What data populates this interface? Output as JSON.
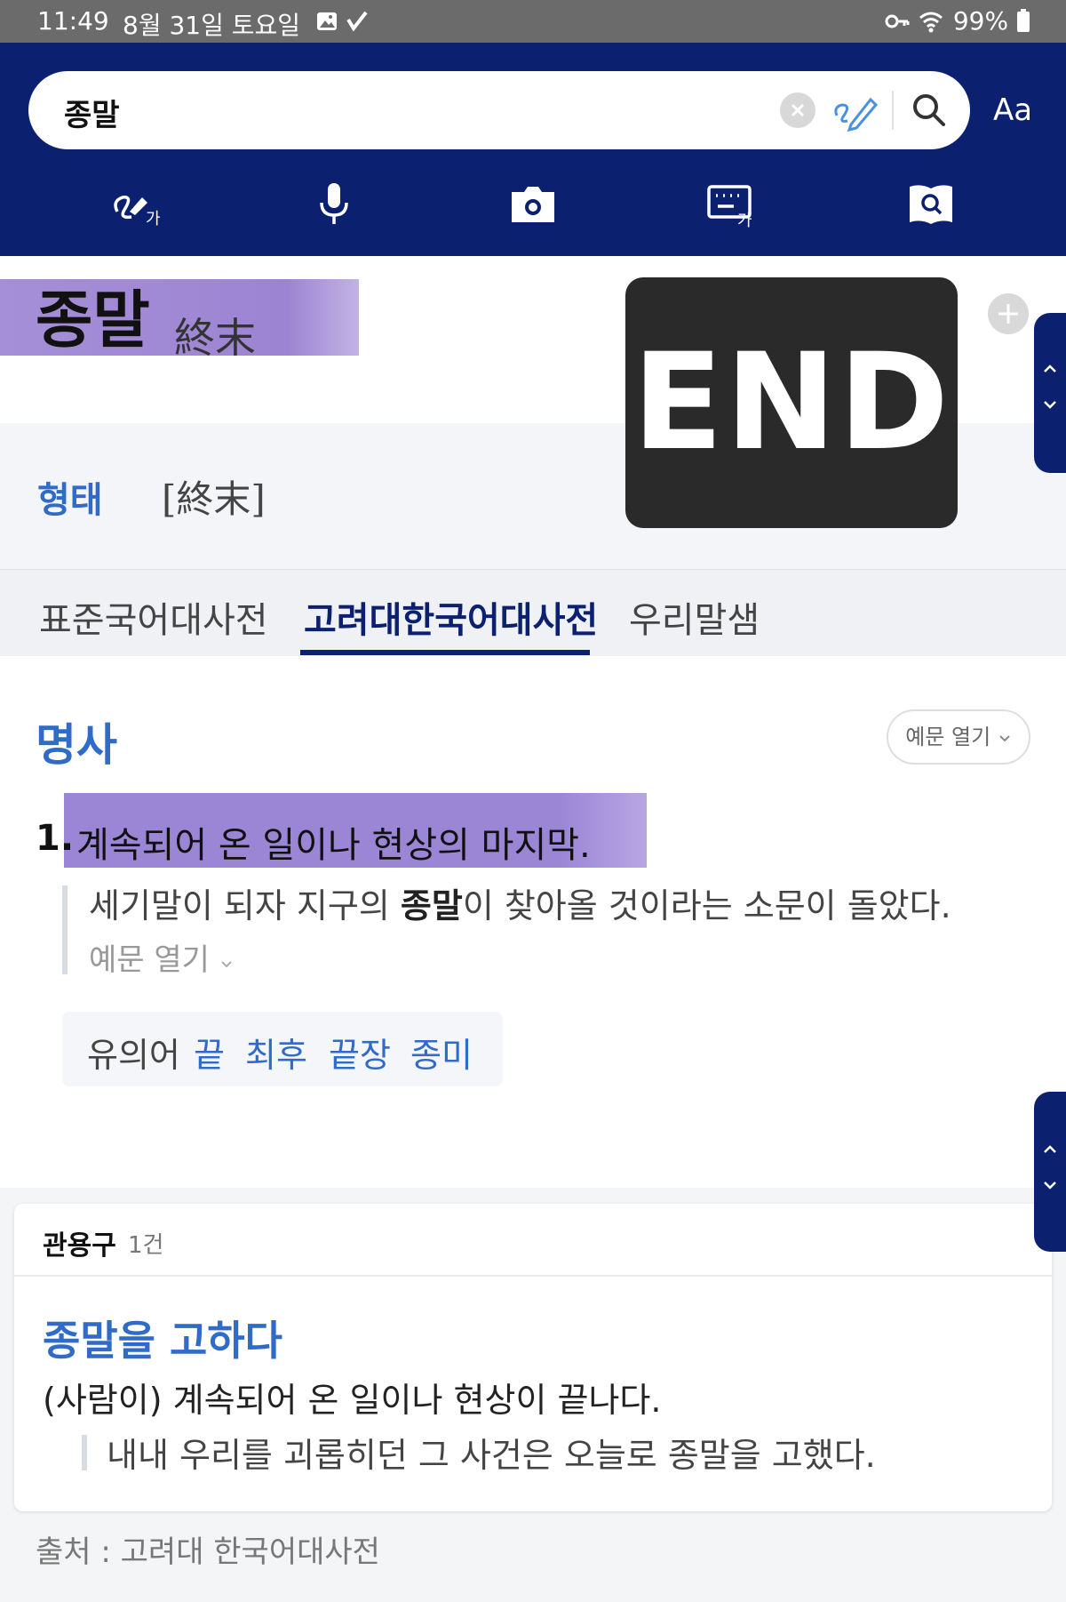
{
  "status_bar": {
    "time": "11:49",
    "date": "8월 31일 토요일",
    "battery": "99%",
    "icons": [
      "gallery-icon",
      "check-icon",
      "key-icon",
      "wifi-icon",
      "battery-icon"
    ]
  },
  "search": {
    "query": "종말",
    "font_size_button": "Aa"
  },
  "toolbar": {
    "tools": [
      "handwriting-icon",
      "microphone-icon",
      "camera-icon",
      "keyboard-icon",
      "book-search-icon"
    ]
  },
  "entry": {
    "headword": "종말",
    "hanja": "終末",
    "image_text": "END",
    "form_label": "형태",
    "form_value": "[終末]"
  },
  "tabs": [
    {
      "label": "표준국어대사전",
      "active": false
    },
    {
      "label": "고려대한국어대사전",
      "active": true
    },
    {
      "label": "우리말샘",
      "active": false
    }
  ],
  "sense": {
    "pos": "명사",
    "example_toggle": "예문 열기",
    "number": "1.",
    "definition": "계속되어 온 일이나 현상의 마지막.",
    "example_before": "세기말이 되자 지구의 ",
    "example_bold": "종말",
    "example_after": "이 찾아올 것이라는 소문이 돌았다.",
    "more_examples": "예문 열기",
    "synonym_label": "유의어",
    "synonyms": [
      "끝",
      "최후",
      "끝장",
      "종미"
    ]
  },
  "idioms": {
    "heading": "관용구",
    "count": "1건",
    "title": "종말을 고하다",
    "definition": "(사람이) 계속되어 온 일이나 현상이 끝나다.",
    "example": "내내 우리를 괴롭히던 그 사건은 오늘로 종말을 고했다."
  },
  "source": "출처 : 고려대 한국어대사전",
  "colors": {
    "header": "#0b2170",
    "link_blue": "#2f6bc7",
    "highlight": "#9b86d6"
  }
}
